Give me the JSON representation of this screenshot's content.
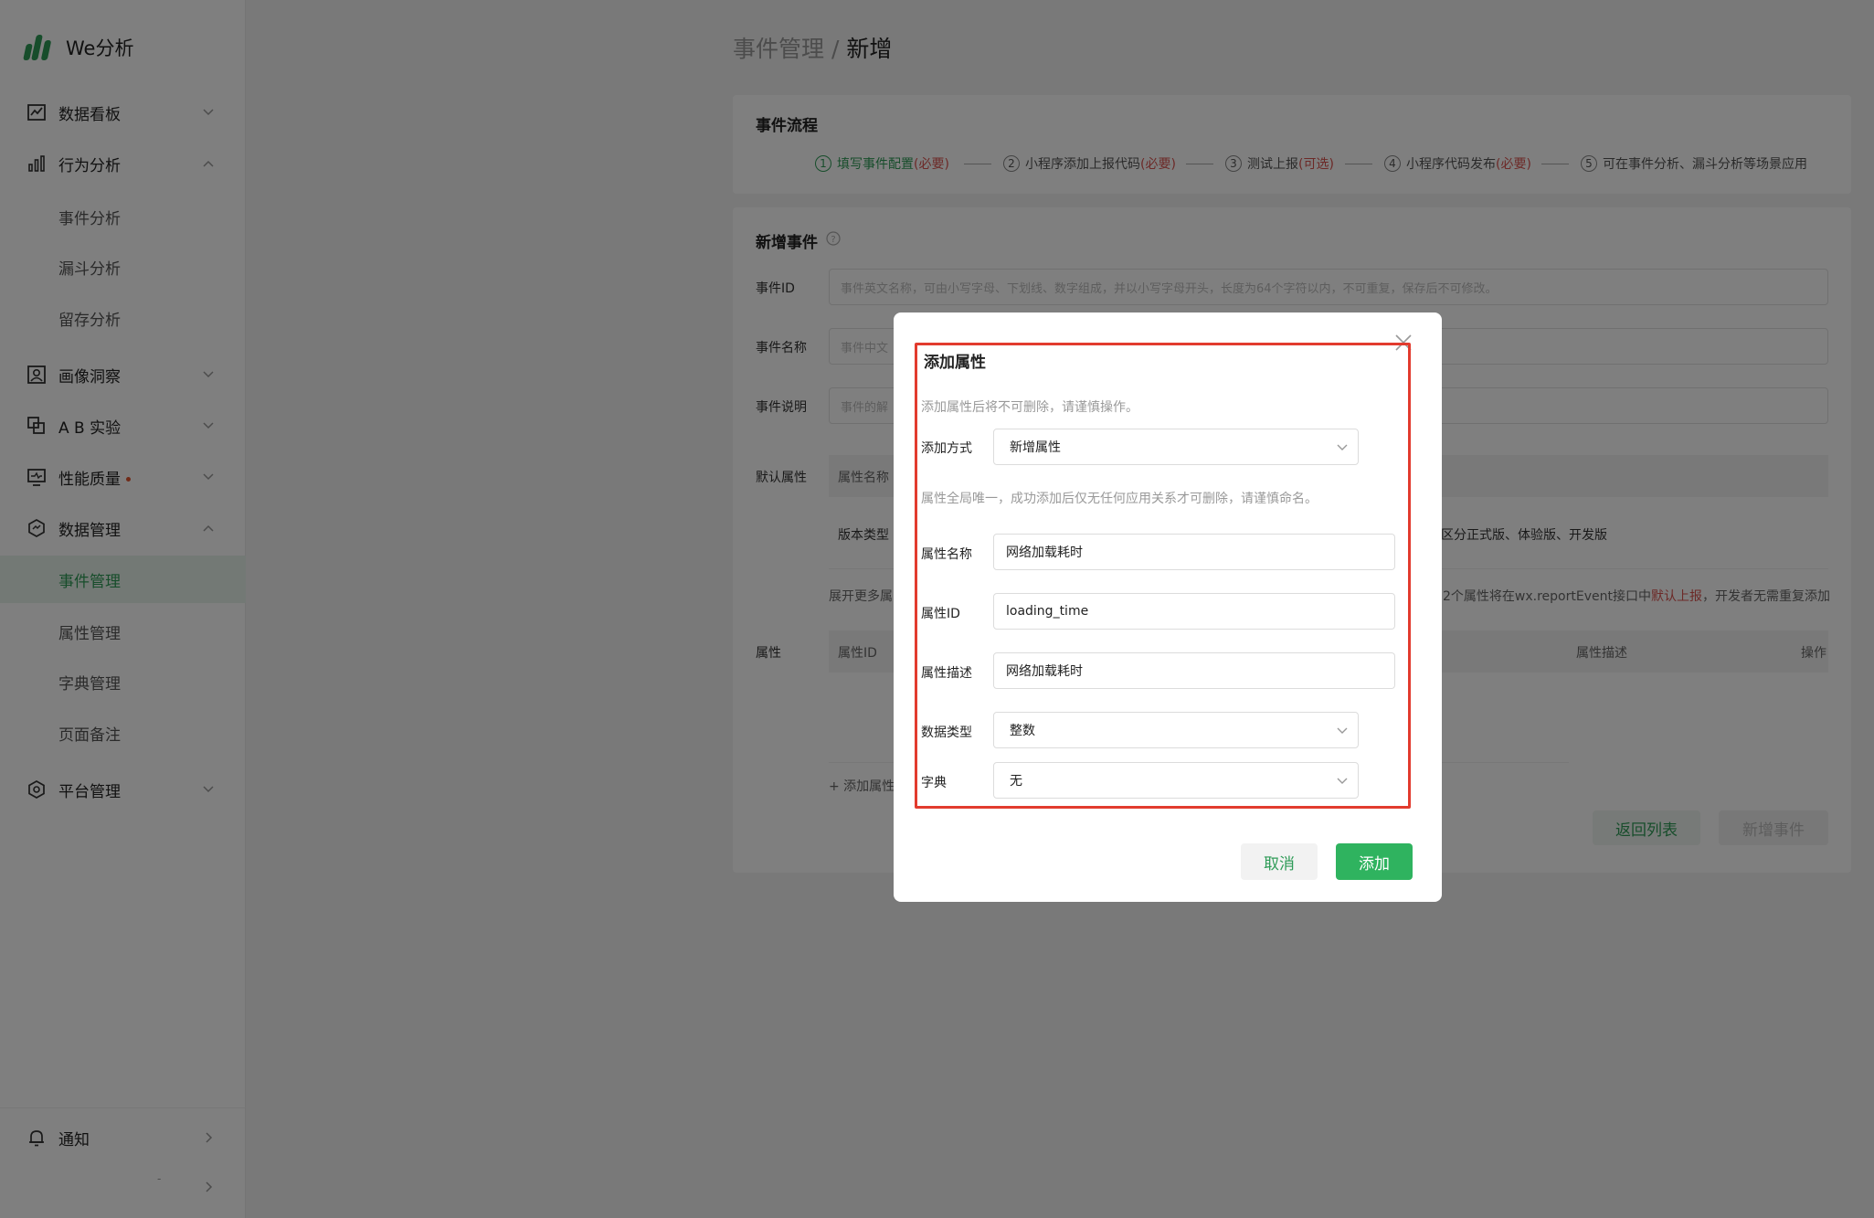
{
  "app": {
    "logo_text": "We分析"
  },
  "sidebar": {
    "groups": [
      {
        "label": "数据看板",
        "icon": "chart-board-icon",
        "expanded": false
      },
      {
        "label": "行为分析",
        "icon": "bar-chart-icon",
        "expanded": true
      },
      {
        "label": "画像洞察",
        "icon": "portrait-icon",
        "expanded": false
      },
      {
        "label": "A B 实验",
        "icon": "ab-test-icon",
        "expanded": false
      },
      {
        "label": "性能质量",
        "icon": "monitor-icon",
        "expanded": false,
        "dot": true
      },
      {
        "label": "数据管理",
        "icon": "data-manage-icon",
        "expanded": true
      },
      {
        "label": "平台管理",
        "icon": "platform-settings-icon",
        "expanded": false
      }
    ],
    "behavior_sub": [
      "事件分析",
      "漏斗分析",
      "留存分析"
    ],
    "data_sub": [
      "事件管理",
      "属性管理",
      "字典管理",
      "页面备注"
    ],
    "active_sub": "事件管理",
    "notify_label": "通知",
    "bottom_marker": "-"
  },
  "header": {
    "parent": "事件管理",
    "separator": "/",
    "current": "新增"
  },
  "flow": {
    "title": "事件流程",
    "steps": [
      {
        "num": "1",
        "text": "填写事件配置",
        "tag": "(必要)"
      },
      {
        "num": "2",
        "text": "小程序添加上报代码",
        "tag": "(必要)"
      },
      {
        "num": "3",
        "text": "测试上报",
        "tag": "(可选)"
      },
      {
        "num": "4",
        "text": "小程序代码发布",
        "tag": "(必要)"
      },
      {
        "num": "5",
        "text": "可在事件分析、漏斗分析等场景应用",
        "tag": ""
      }
    ]
  },
  "event_form": {
    "title": "新增事件",
    "id_label": "事件ID",
    "id_placeholder": "事件英文名称，可由小写字母、下划线、数字组成，并以小写字母开头，长度为64个字符以内，不可重复，保存后不可修改。",
    "name_label": "事件名称",
    "name_placeholder": "事件中文",
    "desc_label": "事件说明",
    "desc_placeholder": "事件的解",
    "default_attr_label": "默认属性",
    "default_table_header": "属性名称",
    "version_type_label": "版本类型",
    "version_type_value": "区分正式版、体验版、开发版",
    "expand_prefix": "展开更多属",
    "expand_suffix_1": "2个属性将在wx.reportEvent接口中",
    "expand_suffix_link": "默认上报",
    "expand_suffix_2": "，开发者无需重复添加",
    "attr_label": "属性",
    "attr_col_id": "属性ID",
    "attr_col_desc": "属性描述",
    "attr_col_op": "操作",
    "add_attr_link": "+ 添加属性",
    "back_button": "返回列表",
    "submit_button": "新增事件"
  },
  "modal": {
    "title": "添加属性",
    "warning": "添加属性后将不可删除，请谨慎操作。",
    "method_label": "添加方式",
    "method_value": "新增属性",
    "unique_hint": "属性全局唯一，成功添加后仅无任何应用关系才可删除，请谨慎命名。",
    "name_label": "属性名称",
    "name_value": "网络加载耗时",
    "id_label": "属性ID",
    "id_value": "loading_time",
    "desc_label": "属性描述",
    "desc_value": "网络加载耗时",
    "type_label": "数据类型",
    "type_value": "整数",
    "dict_label": "字典",
    "dict_value": "无",
    "cancel_button": "取消",
    "add_button": "添加"
  },
  "colors": {
    "brand": "#2e9b57",
    "highlight": "#e23b2e",
    "required": "#d9534f"
  }
}
